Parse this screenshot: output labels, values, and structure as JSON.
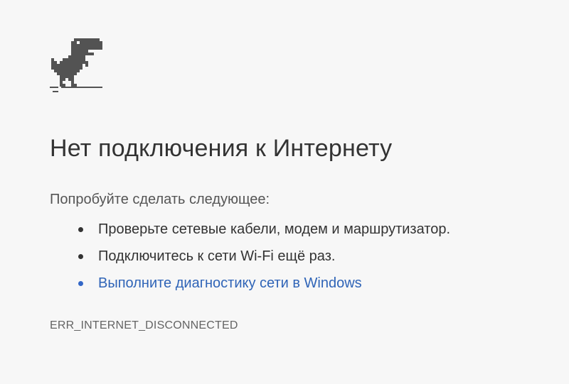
{
  "page": {
    "icon": "offline-dino-icon",
    "title": "Нет подключения к Интернету",
    "suggestions_header": "Попробуйте сделать следующее:",
    "suggestions": [
      {
        "text": "Проверьте сетевые кабели, модем и маршрутизатор.",
        "is_link": false
      },
      {
        "text": "Подключитесь к сети Wi-Fi ещё раз.",
        "is_link": false
      },
      {
        "text": "Выполните диагностику сети в Windows",
        "is_link": true
      }
    ],
    "error_code": "ERR_INTERNET_DISCONNECTED"
  },
  "colors": {
    "background": "#f7f7f7",
    "text": "#333333",
    "link": "#2f64b7",
    "dino": "#535353"
  }
}
